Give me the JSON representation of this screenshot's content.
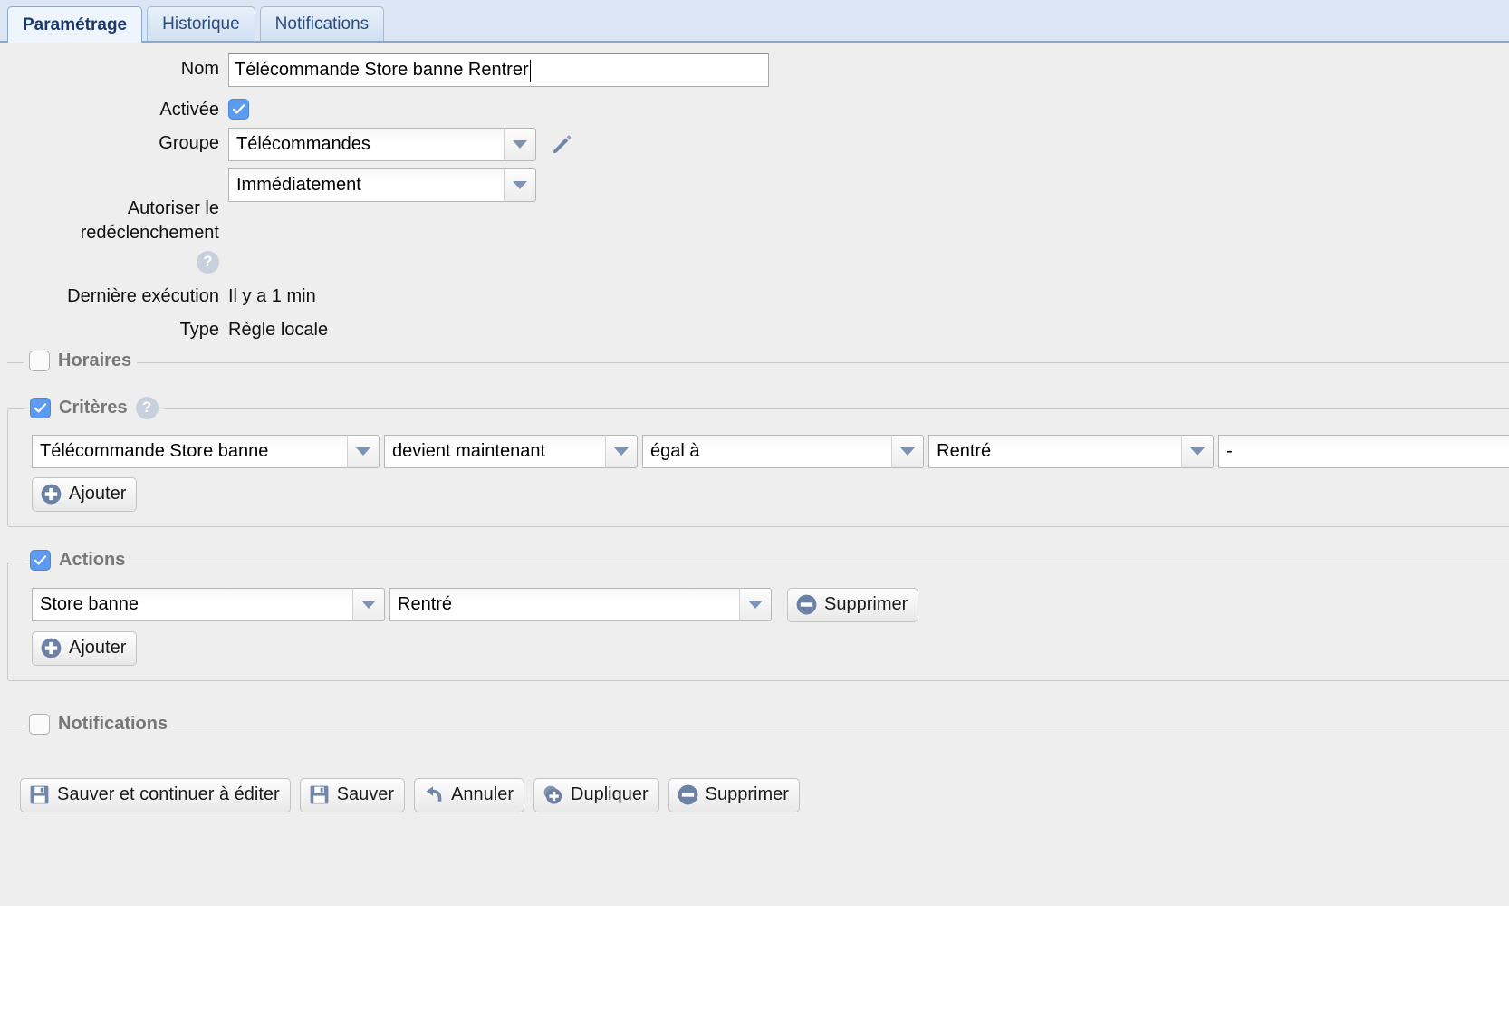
{
  "tabs": [
    {
      "label": "Paramétrage",
      "active": true
    },
    {
      "label": "Historique",
      "active": false
    },
    {
      "label": "Notifications",
      "active": false
    }
  ],
  "form": {
    "nom": {
      "label": "Nom",
      "value": "Télécommande Store banne Rentrer"
    },
    "activee": {
      "label": "Activée",
      "checked": true
    },
    "groupe": {
      "label": "Groupe",
      "value": "Télécommandes",
      "edit_icon": "pencil-icon"
    },
    "redeclenchement": {
      "label": "Autoriser le redéclenchement",
      "value": "Immédiatement",
      "help_icon": "help-icon",
      "help_glyph": "?"
    },
    "derniere_execution": {
      "label": "Dernière exécution",
      "value": "Il y a 1 min"
    },
    "type": {
      "label": "Type",
      "value": "Règle locale"
    }
  },
  "sections": {
    "horaires": {
      "label": "Horaires",
      "checked": false
    },
    "criteres": {
      "label": "Critères",
      "checked": true,
      "help_glyph": "?",
      "rows": [
        {
          "source": "Télécommande Store banne",
          "event": "devient maintenant",
          "operator": "égal à",
          "value": "Rentré",
          "extra": "-"
        }
      ],
      "add_label": "Ajouter"
    },
    "actions": {
      "label": "Actions",
      "checked": true,
      "rows": [
        {
          "device": "Store banne",
          "command": "Rentré",
          "delete_label": "Supprimer"
        }
      ],
      "add_label": "Ajouter"
    },
    "notifications": {
      "label": "Notifications",
      "checked": false
    }
  },
  "toolbar": {
    "save_continue_label": "Sauver et continuer à éditer",
    "save_label": "Sauver",
    "cancel_label": "Annuler",
    "duplicate_label": "Dupliquer",
    "delete_label": "Supprimer"
  },
  "colors": {
    "tab_active_text": "#1b3a6b",
    "tab_bar_bg": "#dbe6f4",
    "panel_bg": "#eeeeee",
    "checkbox_on": "#5d9bf0",
    "legend_text": "#777777",
    "icon_blue": "#6c82a5"
  }
}
